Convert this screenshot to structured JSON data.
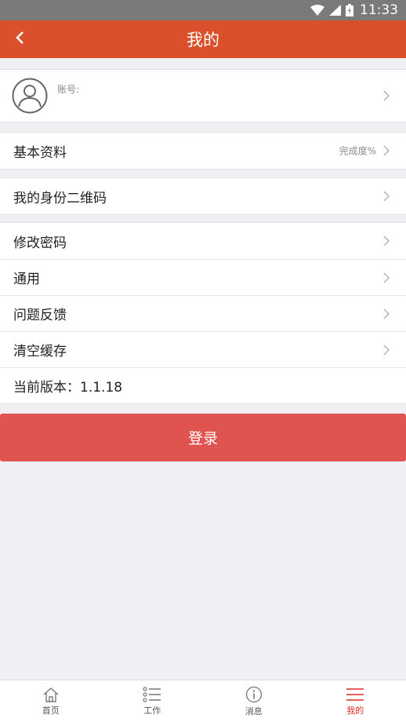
{
  "status_bar": {
    "time": "11:33"
  },
  "header": {
    "title": "我的"
  },
  "profile": {
    "account_label": "账号:"
  },
  "basic_info": {
    "label": "基本资料",
    "completion_hint": "完成度%"
  },
  "qr_code": {
    "label": "我的身份二维码"
  },
  "settings": {
    "items": [
      {
        "label": "修改密码"
      },
      {
        "label": "通用"
      },
      {
        "label": "问题反馈"
      },
      {
        "label": "清空缓存"
      },
      {
        "label": "当前版本：1.1.18"
      }
    ]
  },
  "login_button": {
    "label": "登录"
  },
  "tabs": [
    {
      "label": "首页",
      "icon": "home-icon"
    },
    {
      "label": "工作",
      "icon": "list-icon"
    },
    {
      "label": "消息",
      "icon": "info-icon"
    },
    {
      "label": "我的",
      "icon": "menu-icon"
    }
  ],
  "colors": {
    "header": "#d9502b",
    "login": "#e05450",
    "active_tab": "#e12b25",
    "background": "#efeff4"
  }
}
